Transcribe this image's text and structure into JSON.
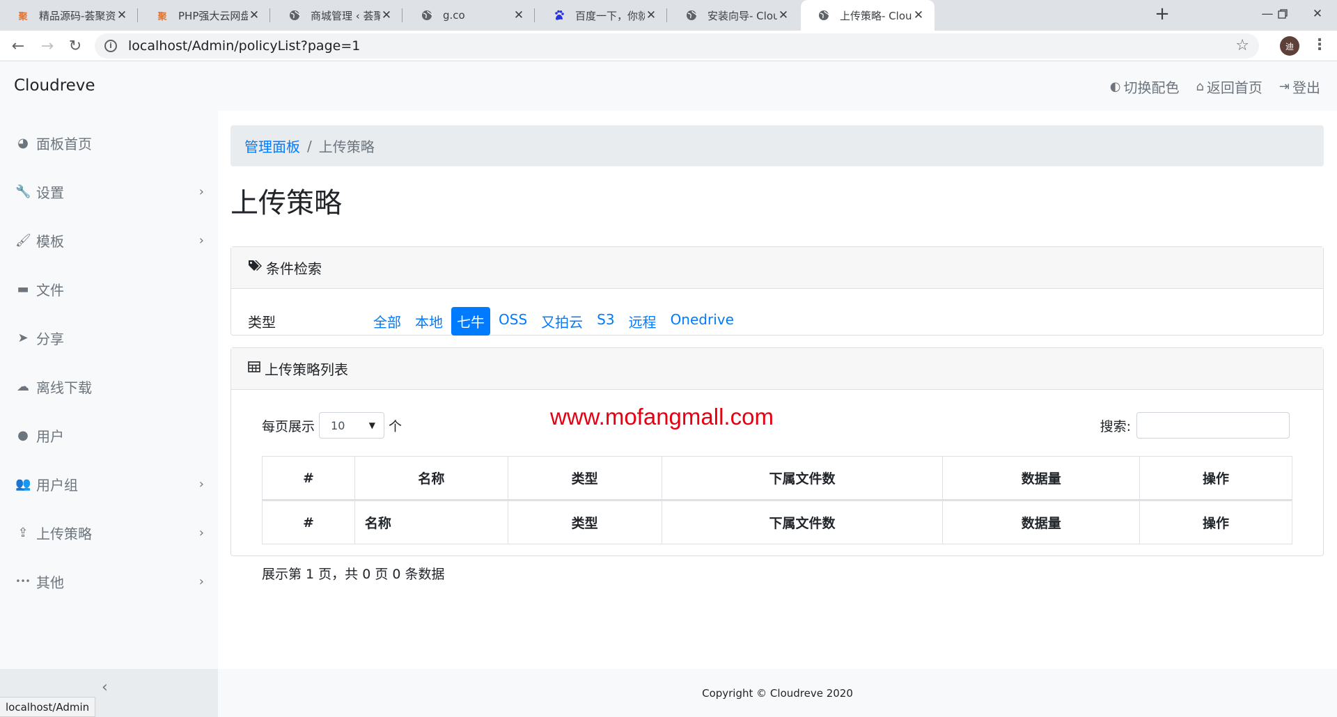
{
  "browser": {
    "tabs": [
      {
        "title": "精品源码-荟聚资源",
        "favicon": "聚"
      },
      {
        "title": "PHP强大云网盘系统源码",
        "favicon": "聚"
      },
      {
        "title": "商城管理 ‹ 荟聚资源 —",
        "favicon": "globe"
      },
      {
        "title": "g.co",
        "favicon": "globe"
      },
      {
        "title": "百度一下，你就知道",
        "favicon": "baidu"
      },
      {
        "title": "安装向导- Cloudreve",
        "favicon": "globe"
      },
      {
        "title": "上传策略- Cloudreve",
        "favicon": "globe"
      }
    ],
    "url": "localhost/Admin/policyList?page=1",
    "profile_initial": "迪",
    "status_url": "localhost/Admin"
  },
  "app": {
    "brand": "Cloudreve",
    "topnav": [
      {
        "label": "切换配色",
        "icon": "toggle-icon"
      },
      {
        "label": "返回首页",
        "icon": "home-icon"
      },
      {
        "label": "登出",
        "icon": "sign-out-icon"
      }
    ],
    "sidebar": [
      {
        "label": "面板首页",
        "icon": "dashboard-icon",
        "chevron": false
      },
      {
        "label": "设置",
        "icon": "wrench-icon",
        "chevron": true
      },
      {
        "label": "模板",
        "icon": "brush-icon",
        "chevron": true
      },
      {
        "label": "文件",
        "icon": "folder-icon",
        "chevron": false
      },
      {
        "label": "分享",
        "icon": "send-icon",
        "chevron": false
      },
      {
        "label": "离线下载",
        "icon": "cloud-download-icon",
        "chevron": false
      },
      {
        "label": "用户",
        "icon": "user-icon",
        "chevron": false
      },
      {
        "label": "用户组",
        "icon": "users-icon",
        "chevron": true
      },
      {
        "label": "上传策略",
        "icon": "upload-icon",
        "chevron": true
      },
      {
        "label": "其他",
        "icon": "ellipsis-icon",
        "chevron": true
      }
    ],
    "breadcrumb": {
      "parent": "管理面板",
      "separator": "/",
      "current": "上传策略"
    },
    "page_title": "上传策略",
    "filter_card": {
      "header": "条件检索",
      "type_label": "类型",
      "options": [
        "全部",
        "本地",
        "七牛",
        "OSS",
        "又拍云",
        "S3",
        "远程",
        "Onedrive"
      ],
      "active_option": "七牛"
    },
    "watermark": "www.mofangmall.com",
    "list_card": {
      "header": "上传策略列表",
      "length_prefix": "每页展示",
      "length_value": "10",
      "length_suffix": "个",
      "search_label": "搜索:",
      "columns": [
        "#",
        "名称",
        "类型",
        "下属文件数",
        "数据量",
        "操作"
      ],
      "info": "展示第 1 页，共 0 页 0 条数据"
    },
    "footer": "Copyright © Cloudreve 2020"
  },
  "colors": {
    "primary": "#007bff",
    "watermark": "#e60012",
    "sidebar_bg": "#f8f9fa"
  }
}
